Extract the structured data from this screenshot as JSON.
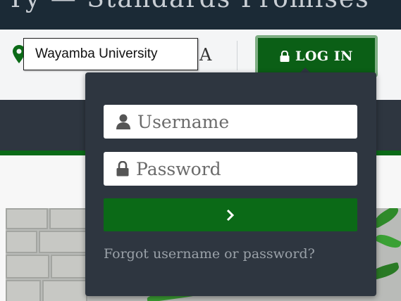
{
  "banner": {
    "tagline": "Ty — Standards Promises"
  },
  "header": {
    "tooltip_text": "Wayamba University",
    "site_suffix": "A",
    "login_label": "LOG IN"
  },
  "login_form": {
    "username_placeholder": "Username",
    "password_placeholder": "Password",
    "submit_glyph": "›",
    "forgot_link": "Forgot username or password?"
  },
  "icons": {
    "pin": "map-pin-icon",
    "lock": "lock-icon",
    "user": "user-icon",
    "chevron": "chevron-right-icon"
  },
  "colors": {
    "brand_green": "#0b6a17",
    "dark_panel": "#2e3640",
    "banner": "#1b2a36"
  }
}
